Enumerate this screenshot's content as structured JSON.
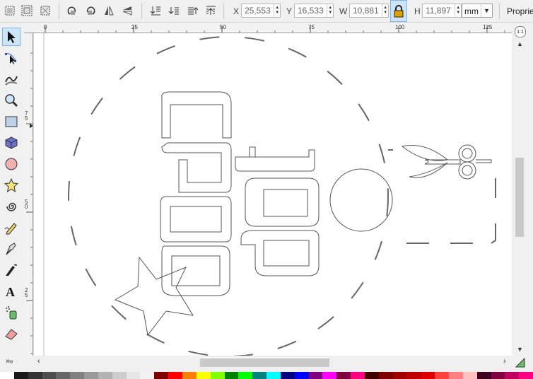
{
  "toolbar": {
    "x_label": "X",
    "x_value": "25,553",
    "y_label": "Y",
    "y_value": "16,533",
    "w_label": "W",
    "w_value": "10,881",
    "h_label": "H",
    "h_value": "11,897",
    "unit": "mm",
    "properties_label": "Proprie"
  },
  "ruler": {
    "top_ticks": [
      "0",
      "25",
      "50",
      "75",
      "100",
      "125"
    ],
    "left_ticks": [
      "75",
      "50",
      "25"
    ]
  },
  "icons": {
    "select_all": "select-all-icon",
    "select_all_layers": "select-all-in-all-layers-icon",
    "deselect": "deselect-icon",
    "rotate_ccw": "rotate-ccw-icon",
    "rotate_cw": "rotate-cw-icon",
    "flip_h": "flip-horizontal-icon",
    "flip_v": "flip-vertical-icon",
    "lower_bottom": "lower-to-bottom-icon",
    "lower": "lower-icon",
    "raise": "raise-icon",
    "raise_top": "raise-to-top-icon",
    "lock": "lock-icon",
    "zoom": "zoom-icon"
  },
  "palette": [
    "#ffffff",
    "#1a1a1a",
    "#333333",
    "#4d4d4d",
    "#666666",
    "#808080",
    "#999999",
    "#b3b3b3",
    "#cccccc",
    "#e6e6e6",
    "#f2f2f2",
    "#800000",
    "#ff0000",
    "#ff8000",
    "#ffff00",
    "#80ff00",
    "#008000",
    "#00ff00",
    "#008080",
    "#00ffff",
    "#000080",
    "#0000ff",
    "#800080",
    "#ff00ff",
    "#800040",
    "#ff0080",
    "#400000",
    "#800000",
    "#a00000",
    "#c00000",
    "#e00000",
    "#ff4040",
    "#ff8080",
    "#ffc0c0",
    "#400020",
    "#800040",
    "#c00060",
    "#ff0080"
  ]
}
